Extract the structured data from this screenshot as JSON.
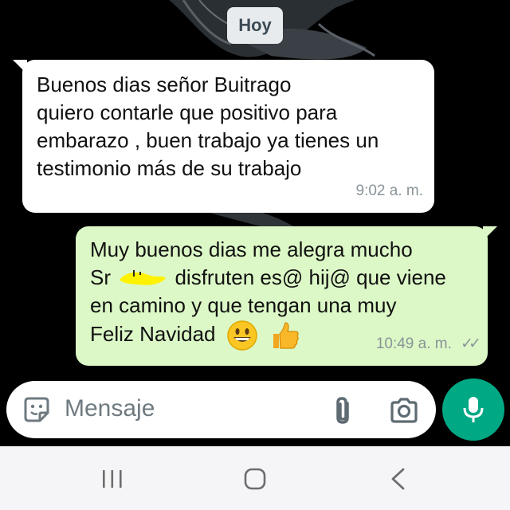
{
  "chat": {
    "date_label": "Hoy",
    "messages": [
      {
        "direction": "incoming",
        "lines": [
          "Buenos dias señor Buitrago",
          "quiero contarle que positivo para",
          "embarazo , buen trabajo ya tienes un",
          "testimonio más de su trabajo"
        ],
        "time": "9:02 a. m."
      },
      {
        "direction": "outgoing",
        "line1": "Muy buenos dias me alegra mucho",
        "line2_prefix": "Sr",
        "line2_suffix": "disfruten es@ hij@ que viene",
        "line3": "en camino y que tengan una muy",
        "line4": "Feliz Navidad",
        "emojis": [
          "grinning-face-emoji",
          "thumbs-up-emoji"
        ],
        "time": "10:49 a. m.",
        "status": "delivered-double-check"
      }
    ]
  },
  "composer": {
    "placeholder": "Mensaje",
    "icons": [
      "emoji-sticker-icon",
      "paperclip-icon",
      "camera-icon",
      "microphone-icon"
    ]
  },
  "navigation_bar": {
    "icons": [
      "recents-icon",
      "home-icon",
      "back-icon"
    ]
  },
  "colors": {
    "outgoing_bubble": "#dcf8c6",
    "incoming_bubble": "#ffffff",
    "accent": "#00a884",
    "redaction_highlight": "#fff200"
  }
}
